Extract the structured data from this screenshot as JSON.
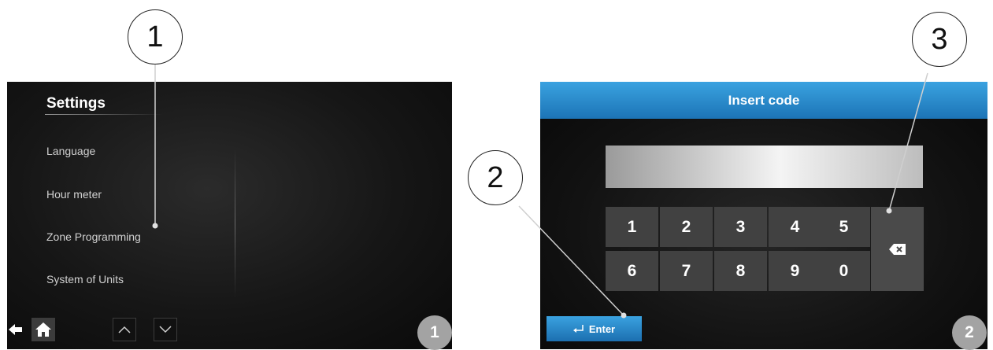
{
  "screen1": {
    "title": "Settings",
    "menu": [
      "Language",
      "Hour meter",
      "Zone Programming",
      "System of Units"
    ],
    "toolbar": {
      "back_icon": "arrow-left-icon",
      "home_icon": "home-icon",
      "up_icon": "chevron-up-icon",
      "down_icon": "chevron-down-icon"
    },
    "badge": "1"
  },
  "screen2": {
    "header": "Insert code",
    "code_value": "",
    "keypad_row1": [
      "1",
      "2",
      "3",
      "4",
      "5"
    ],
    "keypad_row2": [
      "6",
      "7",
      "8",
      "9",
      "0"
    ],
    "backspace_icon": "backspace-icon",
    "enter_label": "Enter",
    "enter_icon": "return-arrow-icon",
    "badge": "2"
  },
  "callouts": [
    "1",
    "2",
    "3"
  ],
  "colors": {
    "accent_blue": "#2a8ccc",
    "key_gray": "#414141",
    "badge_gray": "#a3a3a3"
  }
}
